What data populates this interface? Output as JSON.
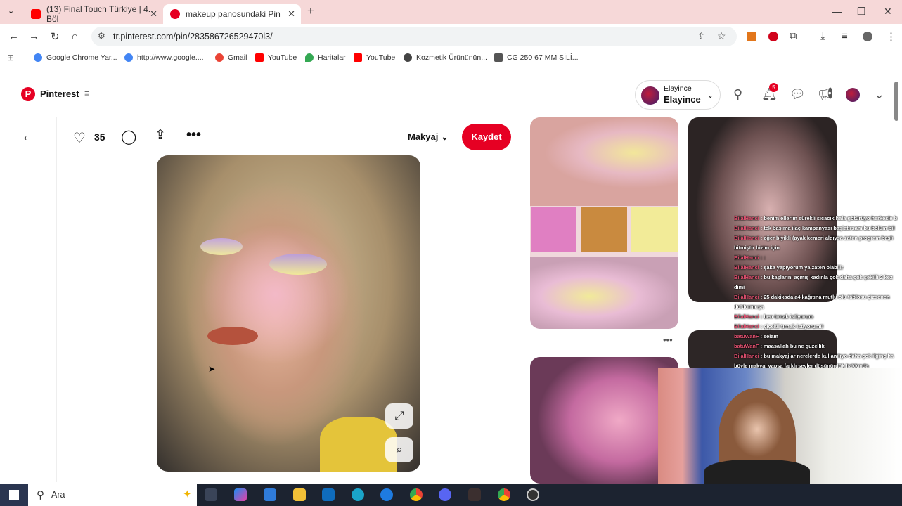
{
  "browser": {
    "tabs": [
      {
        "title": "(13) Final Touch Türkiye | 4. Böl",
        "icon": "youtube-icon"
      },
      {
        "title": "makeup panosundaki Pin",
        "icon": "pinterest-icon"
      }
    ],
    "new_tab": "+",
    "url": "tr.pinterest.com/pin/283586726529470l3/",
    "bookmarks": [
      "Google Chrome Yar...",
      "http://www.google....",
      "Gmail",
      "YouTube",
      "Haritalar",
      "YouTube",
      "Kozmetik Ürününün...",
      "CG 250 67 MM SİLİ..."
    ]
  },
  "pinterest": {
    "brand": "Pinterest",
    "account_label": "Elayince",
    "account_name": "Elayince",
    "notifications": "5",
    "pin": {
      "likes": "35",
      "board": "Makyaj",
      "save_label": "Kaydet",
      "more": "•••"
    },
    "related_more": "•••"
  },
  "stream_chat": [
    {
      "user": "BilalHanci",
      "msg": "benim ellerim sürekli sıcacık hala götürüyo herkesle b"
    },
    {
      "user": "BilalHanci",
      "msg": "tek başıma ilaç kampanyası başlatırsam bu bölüm bil"
    },
    {
      "user": "BilalHanci",
      "msg": "eğer biyikli (ayak kemeri aldıysa zaten program başlı"
    },
    {
      "user": "",
      "msg": "bitmiştir bizim için"
    },
    {
      "user": "BilalHanci",
      "msg": ":"
    },
    {
      "user": "BilalHanci",
      "msg": "şaka yapıyorum ya zaten olabilir"
    },
    {
      "user": "BilalHanci",
      "msg": "bu kaşlarını açmış kadınla çok daha çok şekilli 2 kez"
    },
    {
      "user": "",
      "msg": "dimi"
    },
    {
      "user": "BilalHanci",
      "msg": "25 dakikada a4 kağıtına mutlu olu tablosu çizsenen"
    },
    {
      "user": "",
      "msg": "doldurmuşa"
    },
    {
      "user": "BilalHanci",
      "msg": "ben tırnak istiyorum"
    },
    {
      "user": "BilalHanci",
      "msg": "çiçekli tırnak istiyorum!!"
    },
    {
      "user": "batuWanF",
      "msg": "selam"
    },
    {
      "user": "batuWanF",
      "msg": "maasallah bu ne guzellik"
    },
    {
      "user": "BilalHanci",
      "msg": "bu makyajlar nerelerde kullanılıyo daha çok ilginç ha"
    },
    {
      "user": "",
      "msg": "böyle makyaj yapsa farklı şeyler düşünürdük hakkında"
    }
  ],
  "taskbar": {
    "search_placeholder": "Ara"
  },
  "colors": {
    "pinterest_red": "#e60023",
    "tab_strip": "#f6d8d8",
    "taskbar": "#1c2330"
  }
}
